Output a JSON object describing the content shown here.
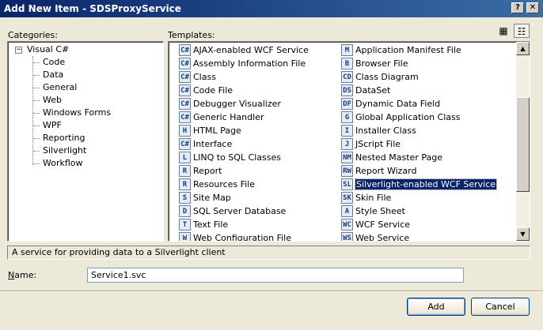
{
  "window": {
    "title": "Add New Item - SDSProxyService",
    "help_btn": "?",
    "close_btn": "✕"
  },
  "labels": {
    "categories": "Categories:",
    "templates": "Templates:",
    "name": "Name:"
  },
  "categories": {
    "root": "Visual C#",
    "expander": "−",
    "children": [
      "Code",
      "Data",
      "General",
      "Web",
      "Windows Forms",
      "WPF",
      "Reporting",
      "Silverlight",
      "Workflow"
    ]
  },
  "templates": {
    "left": [
      {
        "label": "AJAX-enabled WCF Service",
        "icon": "C#"
      },
      {
        "label": "Assembly Information File",
        "icon": "C#"
      },
      {
        "label": "Class",
        "icon": "C#"
      },
      {
        "label": "Code File",
        "icon": "C#"
      },
      {
        "label": "Debugger Visualizer",
        "icon": "C#"
      },
      {
        "label": "Generic Handler",
        "icon": "C#"
      },
      {
        "label": "HTML Page",
        "icon": "H"
      },
      {
        "label": "Interface",
        "icon": "C#"
      },
      {
        "label": "LINQ to SQL Classes",
        "icon": "L"
      },
      {
        "label": "Report",
        "icon": "R"
      },
      {
        "label": "Resources File",
        "icon": "R"
      },
      {
        "label": "Site Map",
        "icon": "S"
      },
      {
        "label": "SQL Server Database",
        "icon": "D"
      },
      {
        "label": "Text File",
        "icon": "T"
      },
      {
        "label": "Web Configuration File",
        "icon": "W"
      }
    ],
    "right": [
      {
        "label": "Application Manifest File",
        "icon": "M"
      },
      {
        "label": "Browser File",
        "icon": "B"
      },
      {
        "label": "Class Diagram",
        "icon": "CD"
      },
      {
        "label": "DataSet",
        "icon": "DS"
      },
      {
        "label": "Dynamic Data Field",
        "icon": "DF"
      },
      {
        "label": "Global Application Class",
        "icon": "G"
      },
      {
        "label": "Installer Class",
        "icon": "I"
      },
      {
        "label": "JScript File",
        "icon": "J"
      },
      {
        "label": "Nested Master Page",
        "icon": "NM"
      },
      {
        "label": "Report Wizard",
        "icon": "RW"
      },
      {
        "label": "Silverlight-enabled WCF Service",
        "icon": "SL",
        "selected": true
      },
      {
        "label": "Skin File",
        "icon": "SK"
      },
      {
        "label": "Style Sheet",
        "icon": "A"
      },
      {
        "label": "WCF Service",
        "icon": "WC"
      },
      {
        "label": "Web Service",
        "icon": "WS"
      }
    ]
  },
  "description": "A service for providing data to a Silverlight client",
  "name_value": "Service1.svc",
  "buttons": {
    "add": "Add",
    "cancel": "Cancel"
  },
  "view_icons": {
    "large": "▦",
    "small": "☷"
  },
  "scroll_arrows": {
    "up": "▲",
    "down": "▼"
  }
}
